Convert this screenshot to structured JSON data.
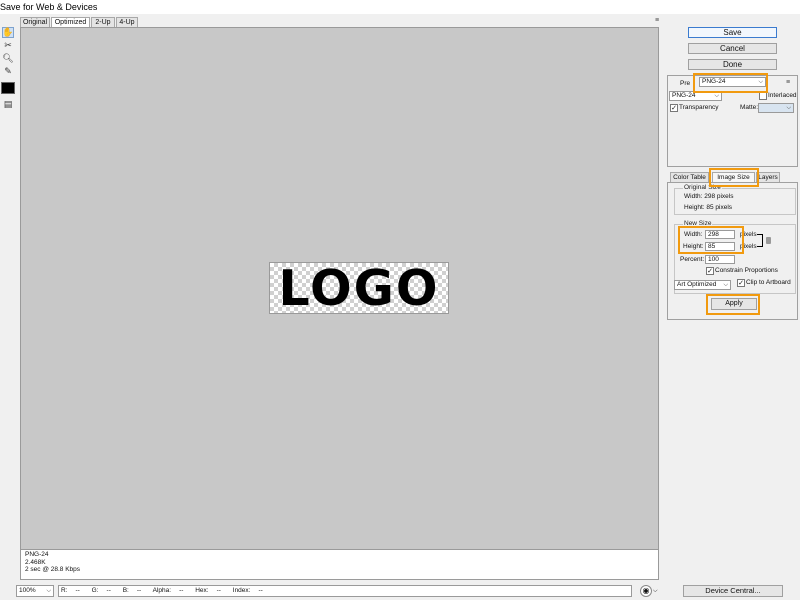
{
  "window": {
    "title": "Save for Web & Devices"
  },
  "tabs": [
    {
      "label": "Original",
      "active": false
    },
    {
      "label": "Optimized",
      "active": true
    },
    {
      "label": "2-Up",
      "active": false
    },
    {
      "label": "4-Up",
      "active": false
    }
  ],
  "toolbox": [
    "hand-tool",
    "slice-select-tool",
    "zoom-tool",
    "eyedropper-tool",
    "eyedropper-color-swatch",
    "toggle-slices-visibility"
  ],
  "preview": {
    "logo_text": "LOGO"
  },
  "info": {
    "format": "PNG-24",
    "size": "2.468K",
    "time": "2 sec @ 28.8 Kbps"
  },
  "statusbar": {
    "zoom": "100%",
    "readout": [
      "R:",
      "--",
      "G:",
      "--",
      "B:",
      "--",
      "Alpha:",
      "--",
      "Hex:",
      "--",
      "Index:",
      "--"
    ]
  },
  "actions": {
    "save": "Save",
    "cancel": "Cancel",
    "done": "Done",
    "device_central": "Device Central..."
  },
  "preset": {
    "label": "Preset:",
    "value": "PNG-24",
    "label_visible": "Pre"
  },
  "settings": {
    "format": "PNG-24",
    "interlaced_label": "Interlaced",
    "interlaced": false,
    "transparency_label": "Transparency",
    "transparency": true,
    "matte_label": "Matte:"
  },
  "panel_tabs": [
    {
      "label": "Color Table",
      "active": false
    },
    {
      "label": "Image Size",
      "active": true
    },
    {
      "label": "Layers",
      "active": false
    }
  ],
  "image_size": {
    "original_title": "Original Size",
    "original_width": "Width: 298 pixels",
    "original_height": "Height: 85 pixels",
    "new_title": "New Size",
    "width_label": "Width:",
    "width_value": "298",
    "height_label": "Height:",
    "height_value": "85",
    "unit": "pixels",
    "percent_label": "Percent:",
    "percent_value": "100",
    "constrain_label": "Constrain Proportions",
    "constrain": true,
    "quality": "Art Optimized",
    "clip_label": "Clip to Artboard",
    "clip": true,
    "apply": "Apply"
  },
  "colors": {
    "highlight": "#f19a0f",
    "canvas": "#c8c8c8",
    "default_button_border": "#3b7bcf"
  }
}
